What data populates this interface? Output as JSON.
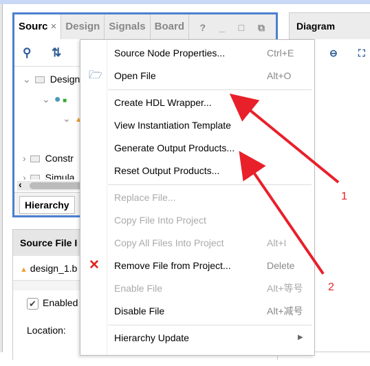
{
  "sources_panel": {
    "tabs": [
      "Sourc",
      "Design",
      "Signals",
      "Board"
    ],
    "tab_close": "×",
    "window_buttons": "? _ □ ⧉",
    "tree": [
      "Design",
      "Constr",
      "Simula"
    ],
    "bottom_tab": "Hierarchy"
  },
  "properties_panel": {
    "title": "Source File I",
    "file": "design_1.b",
    "enabled_label": "Enabled",
    "enabled_checked": true,
    "location_label": "Location:"
  },
  "diagram_panel": {
    "title": "Diagram"
  },
  "context_menu": {
    "items": [
      {
        "label": "Source Node Properties...",
        "shortcut": "Ctrl+E",
        "enabled": true
      },
      {
        "label": "Open File",
        "shortcut": "Alt+O",
        "enabled": true,
        "icon": "folder-open-icon"
      },
      {
        "label": "Create HDL Wrapper...",
        "shortcut": "",
        "enabled": true
      },
      {
        "label": "View Instantiation Template",
        "shortcut": "",
        "enabled": true
      },
      {
        "label": "Generate Output Products...",
        "shortcut": "",
        "enabled": true
      },
      {
        "label": "Reset Output Products...",
        "shortcut": "",
        "enabled": true
      },
      {
        "label": "Replace File...",
        "shortcut": "",
        "enabled": false
      },
      {
        "label": "Copy File Into Project",
        "shortcut": "",
        "enabled": false
      },
      {
        "label": "Copy All Files Into Project",
        "shortcut": "Alt+I",
        "enabled": false
      },
      {
        "label": "Remove File from Project...",
        "shortcut": "Delete",
        "enabled": true,
        "icon": "red-x-icon"
      },
      {
        "label": "Enable File",
        "shortcut": "Alt+等号",
        "enabled": false
      },
      {
        "label": "Disable File",
        "shortcut": "Alt+减号",
        "enabled": true
      },
      {
        "label": "Hierarchy Update",
        "shortcut": "",
        "enabled": true,
        "submenu": true
      }
    ]
  },
  "annotations": {
    "labels": [
      "1",
      "2"
    ],
    "color": "#e8202a"
  }
}
